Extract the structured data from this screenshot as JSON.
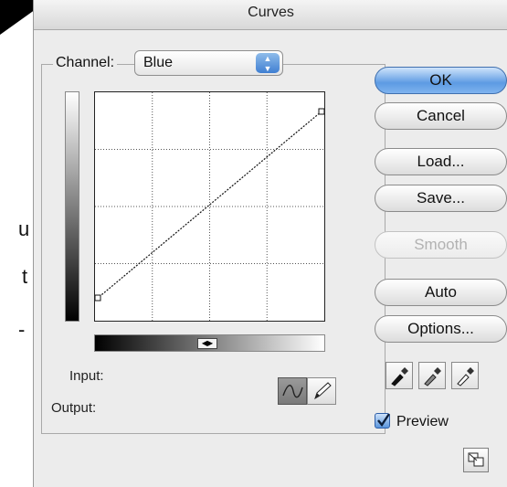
{
  "window": {
    "title": "Curves"
  },
  "channel": {
    "label": "Channel:",
    "value": "Blue"
  },
  "fields": {
    "input_label": "Input:",
    "output_label": "Output:"
  },
  "buttons": {
    "ok": "OK",
    "cancel": "Cancel",
    "load": "Load...",
    "save": "Save...",
    "smooth": "Smooth",
    "auto": "Auto",
    "options": "Options..."
  },
  "button_states": {
    "smooth_disabled": true,
    "ok_default": true
  },
  "preview": {
    "label": "Preview",
    "checked": true
  },
  "curve": {
    "points": [
      [
        0,
        0
      ],
      [
        255,
        255
      ]
    ],
    "grid_divisions": 4
  },
  "tools": {
    "curve_tool_active": true,
    "pencil_tool_active": false
  },
  "background_doc": {
    "chars": [
      "u",
      "t",
      "-"
    ]
  },
  "colors": {
    "accent": "#5d9be3",
    "dialog_bg": "#ececec"
  },
  "icons": [
    "select-arrows-icon",
    "curve-tool-icon",
    "pencil-icon",
    "black-eyedropper-icon",
    "gray-eyedropper-icon",
    "white-eyedropper-icon",
    "checkmark-icon",
    "resize-icon"
  ]
}
